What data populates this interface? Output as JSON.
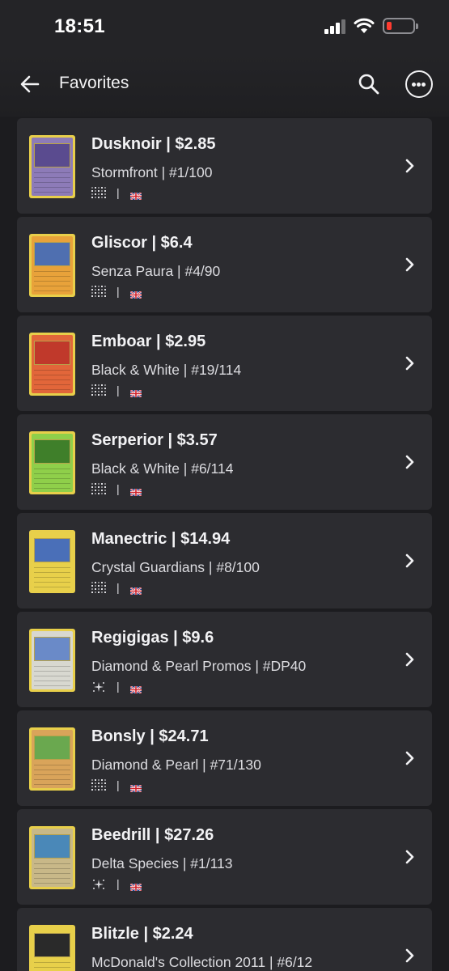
{
  "status_bar": {
    "time": "18:51"
  },
  "header": {
    "title": "Favorites"
  },
  "cards": [
    {
      "name": "Dusknoir",
      "price": "$2.85",
      "set": "Stormfront",
      "number": "#1/100",
      "finish": "pattern",
      "colors": [
        "#8d7bb8",
        "#5a4b8f"
      ]
    },
    {
      "name": "Gliscor",
      "price": "$6.4",
      "set": "Senza Paura",
      "number": "#4/90",
      "finish": "pattern",
      "colors": [
        "#e8a23a",
        "#4f6fb0"
      ]
    },
    {
      "name": "Emboar",
      "price": "$2.95",
      "set": "Black & White",
      "number": "#19/114",
      "finish": "pattern",
      "colors": [
        "#e2663a",
        "#c0392b"
      ]
    },
    {
      "name": "Serperior",
      "price": "$3.57",
      "set": "Black & White",
      "number": "#6/114",
      "finish": "pattern",
      "colors": [
        "#8fcf4a",
        "#3f7f2a"
      ]
    },
    {
      "name": "Manectric",
      "price": "$14.94",
      "set": "Crystal Guardians",
      "number": "#8/100",
      "finish": "pattern",
      "colors": [
        "#e8d04a",
        "#4a6fb8"
      ]
    },
    {
      "name": "Regigigas",
      "price": "$9.6",
      "set": "Diamond & Pearl Promos",
      "number": "#DP40",
      "finish": "sparkle",
      "colors": [
        "#d8d8d0",
        "#6a8ac8"
      ]
    },
    {
      "name": "Bonsly",
      "price": "$24.71",
      "set": "Diamond & Pearl",
      "number": "#71/130",
      "finish": "pattern",
      "colors": [
        "#d9a45a",
        "#6aa84f"
      ]
    },
    {
      "name": "Beedrill",
      "price": "$27.26",
      "set": "Delta Species",
      "number": "#1/113",
      "finish": "sparkle",
      "colors": [
        "#c8b888",
        "#4a88b8"
      ]
    },
    {
      "name": "Blitzle",
      "price": "$2.24",
      "set": "McDonald's Collection 2011",
      "number": "#6/12",
      "finish": "pattern",
      "colors": [
        "#e8d04a",
        "#2a2a2a"
      ]
    }
  ]
}
